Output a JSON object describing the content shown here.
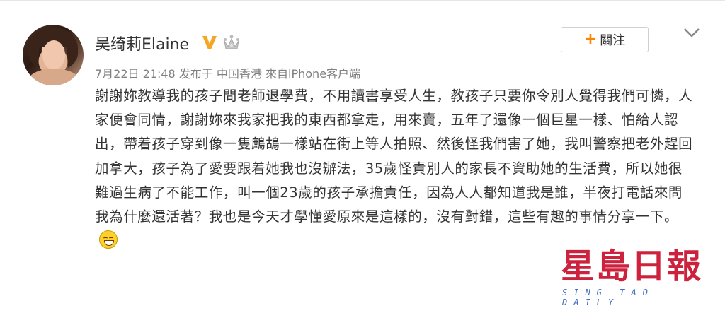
{
  "post": {
    "username": "吴绮莉Elaine",
    "verified_badge": "V",
    "meta": {
      "date": "7月22日 21:48",
      "published_in": "发布于 中国香港",
      "source": "來自iPhone客户端"
    },
    "follow_button": {
      "plus": "+",
      "label": "關注"
    },
    "content": "謝謝妳教導我的孩子問老師退學費，不用讀書享受人生，教孩子只要你令別人覺得我們可憐，人家便會同情，謝謝妳來我家把我的東西都拿走，用來賣，五年了還像一個巨星一樣、怕給人認出，帶着孩子穿到像一隻鷓鴣一樣站在街上等人拍照、然後怪我們害了她，我叫警察把老外趕回加拿大，孩子為了愛要跟着她我也沒辦法，35歲怪責別人的家長不資助她的生活費，所以她很難過生病了不能工作，叫一個23歲的孩子承擔責任，因為人人都知道我是誰，半夜打電話來問我為什麼還活著？我也是今天才學懂愛原來是這樣的，沒有對錯，這些有趣的事情分享一下。",
    "emoji": "grinning-face-icon"
  },
  "watermark": {
    "main": "星島日報",
    "sub": "SING TAO DAILY"
  },
  "colors": {
    "accent_orange": "#ff8200",
    "badge_gold": "#f5a623",
    "watermark_red": "#c8102e",
    "watermark_blue": "#3f6cc0"
  }
}
